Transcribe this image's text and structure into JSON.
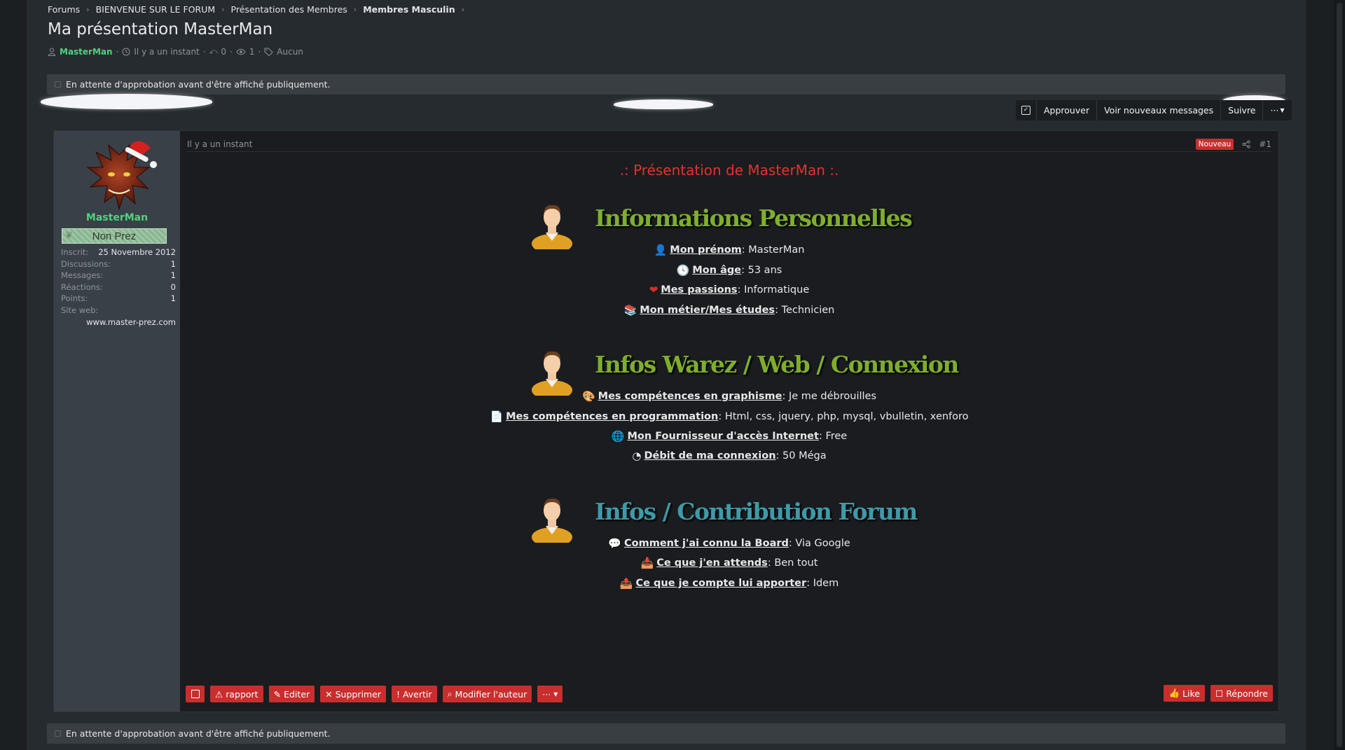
{
  "breadcrumb": {
    "items": [
      "Forums",
      "BIENVENUE SUR LE FORUM",
      "Présentation des Membres",
      "Membres Masculin"
    ]
  },
  "thread": {
    "title": "Ma présentation MasterMan",
    "author": "MasterMan",
    "time": "Il y a un instant",
    "replies": "0",
    "views": "1",
    "tags": "Aucun"
  },
  "notice": {
    "text": "En attente d'approbation avant d'être affiché publiquement."
  },
  "actions": {
    "approve": "Approuver",
    "new_messages": "Voir nouveaux messages",
    "follow": "Suivre",
    "more": "···"
  },
  "user": {
    "name": "MasterMan",
    "rank": "Non Prez",
    "stats": [
      {
        "label": "Inscrit:",
        "value": "25 Novembre 2012"
      },
      {
        "label": "Discussions:",
        "value": "1"
      },
      {
        "label": "Messages:",
        "value": "1"
      },
      {
        "label": "Réactions:",
        "value": "0"
      },
      {
        "label": "Points:",
        "value": "1"
      },
      {
        "label": "Site web:",
        "value": ""
      }
    ],
    "website": "www.master-prez.com"
  },
  "post": {
    "time": "Il y a un instant",
    "badge": "Nouveau",
    "number": "#1",
    "title": ".: Présentation de MasterMan :.",
    "sections": [
      {
        "heading": "Informations Personnelles",
        "lines": [
          {
            "icon": "person-icon",
            "label": "Mon prénom",
            "value": "MasterMan"
          },
          {
            "icon": "clock-icon",
            "label": "Mon âge",
            "value": "53 ans"
          },
          {
            "icon": "heart-icon",
            "label": "Mes passions",
            "value": "Informatique"
          },
          {
            "icon": "books-icon",
            "label": "Mon métier/Mes études",
            "value": "Technicien"
          }
        ]
      },
      {
        "heading": "Infos Warez / Web / Connexion",
        "lines": [
          {
            "icon": "palette-icon",
            "label": "Mes compétences en graphisme",
            "value": "Je me débrouilles"
          },
          {
            "icon": "code-icon",
            "label": "Mes compétences en programmation",
            "value": "Html, css, jquery, php, mysql, vbulletin, xenforo"
          },
          {
            "icon": "globe-icon",
            "label": "Mon Fournisseur d'accès Internet",
            "value": "Free"
          },
          {
            "icon": "gauge-icon",
            "label": "Débit de ma connexion",
            "value": "50 Méga"
          }
        ]
      },
      {
        "heading": "Infos / Contribution Forum",
        "lines": [
          {
            "icon": "chat-icon",
            "label": "Comment j'ai connu la Board",
            "value": "Via Google"
          },
          {
            "icon": "download-icon",
            "label": "Ce que j'en attends",
            "value": "Ben tout"
          },
          {
            "icon": "upload-icon",
            "label": "Ce que je compte lui apporter",
            "value": "Idem"
          }
        ]
      }
    ]
  },
  "toolbar": {
    "report": "rapport",
    "edit": "Editer",
    "delete": "Supprimer",
    "warn": "Avertir",
    "change_author": "Modifier l'auteur",
    "more": "···",
    "like": "Like",
    "reply": "Répondre"
  },
  "colors": {
    "accent": "#c92e2e",
    "username": "#4ed37c",
    "title_red": "#e53131"
  }
}
